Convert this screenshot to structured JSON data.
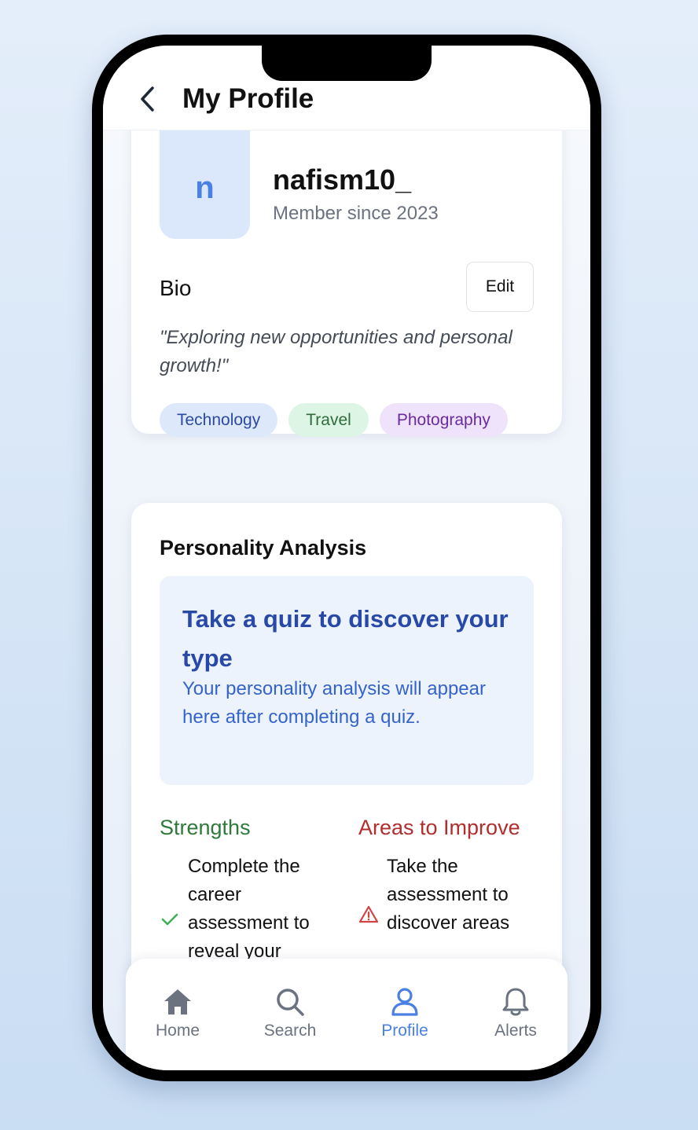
{
  "header": {
    "title": "My Profile"
  },
  "profile": {
    "avatar_initial": "n",
    "username": "nafism10_",
    "member_since": "Member since 2023",
    "bio_label": "Bio",
    "edit_label": "Edit",
    "bio_text": "\"Exploring new opportunities and personal growth!\"",
    "tags": [
      "Technology",
      "Travel",
      "Photography"
    ]
  },
  "analysis": {
    "title": "Personality Analysis",
    "quiz_title": "Take a quiz to discover your type",
    "quiz_desc": "Your personality analysis will appear here after completing a quiz.",
    "strengths": {
      "title": "Strengths",
      "item": "Complete the career assessment to reveal your"
    },
    "improve": {
      "title": "Areas to Improve",
      "item": "Take the assessment to discover areas"
    }
  },
  "tabbar": {
    "items": [
      {
        "label": "Home",
        "icon": "home-icon",
        "active": false
      },
      {
        "label": "Search",
        "icon": "search-icon",
        "active": false
      },
      {
        "label": "Profile",
        "icon": "user-icon",
        "active": true
      },
      {
        "label": "Alerts",
        "icon": "bell-icon",
        "active": false
      }
    ]
  },
  "colors": {
    "accent": "#4a7fe3",
    "quiz_title": "#2849a8",
    "strengths": "#2f7a3a",
    "improve": "#b22d2d"
  }
}
